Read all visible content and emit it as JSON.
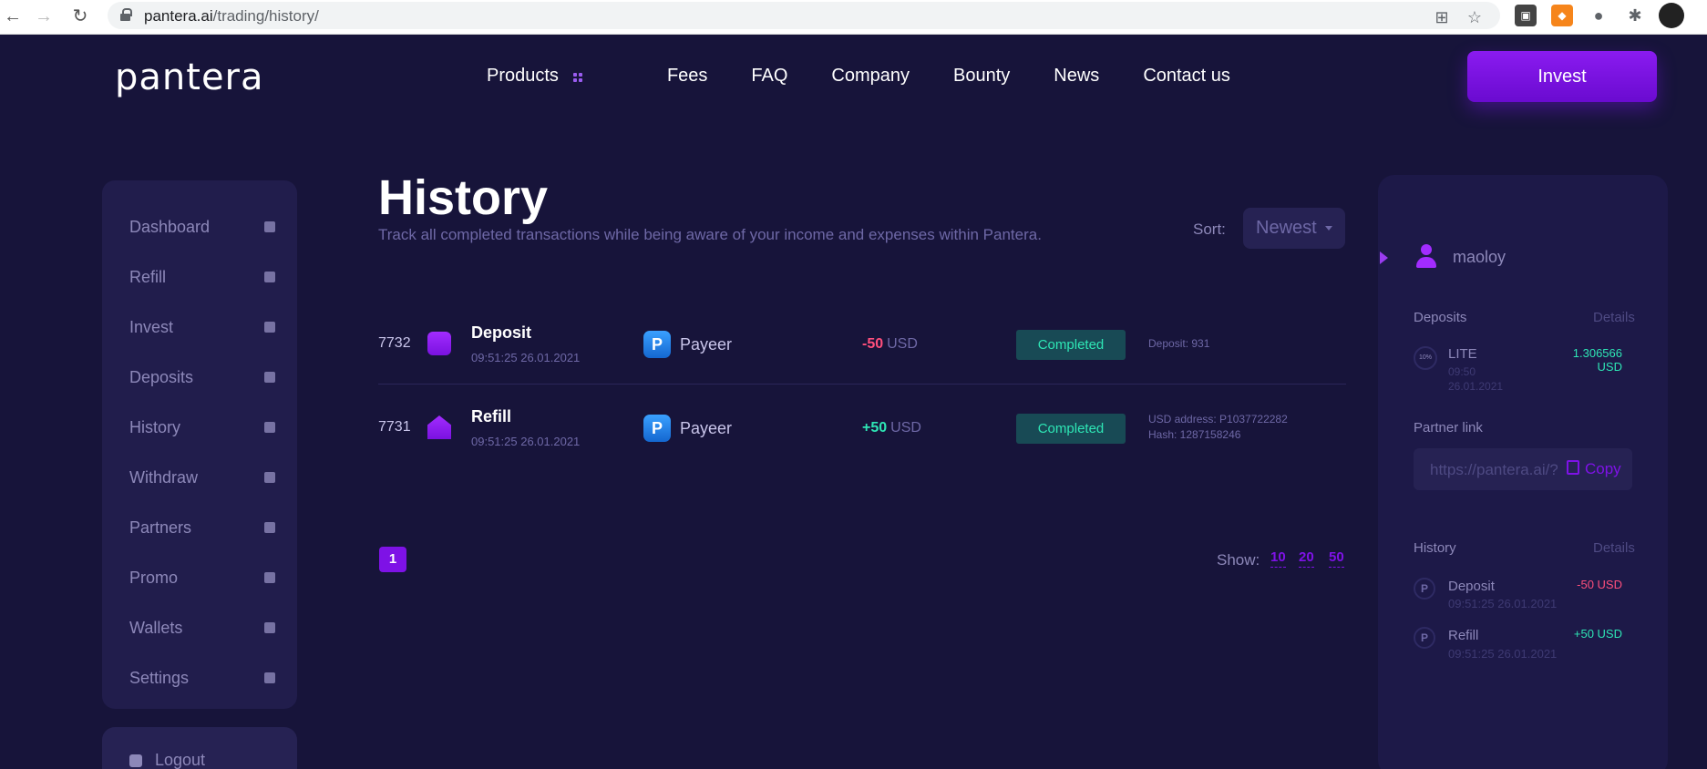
{
  "browser": {
    "url_host": "pantera.ai",
    "url_path": "/trading/history/"
  },
  "header": {
    "logo": "pantera",
    "nav": [
      "Products",
      "Fees",
      "FAQ",
      "Company",
      "Bounty",
      "News",
      "Contact us"
    ],
    "invest_label": "Invest"
  },
  "sidebar": {
    "items": [
      {
        "label": "Dashboard",
        "icon": "home-icon"
      },
      {
        "label": "Refill",
        "icon": "wallet-icon"
      },
      {
        "label": "Invest",
        "icon": "invest-icon"
      },
      {
        "label": "Deposits",
        "icon": "deposits-icon"
      },
      {
        "label": "History",
        "icon": "history-icon"
      },
      {
        "label": "Withdraw",
        "icon": "withdraw-icon"
      },
      {
        "label": "Partners",
        "icon": "partners-icon"
      },
      {
        "label": "Promo",
        "icon": "star-icon"
      },
      {
        "label": "Wallets",
        "icon": "wallets-icon"
      },
      {
        "label": "Settings",
        "icon": "gear-icon"
      }
    ],
    "logout": "Logout"
  },
  "main": {
    "title": "History",
    "subtitle": "Track all completed transactions while being aware of your income and expenses within Pantera.",
    "sort_label": "Sort:",
    "sort_value": "Newest",
    "rows": [
      {
        "id": "7732",
        "type": "Deposit",
        "date": "09:51:25 26.01.2021",
        "method": "Payeer",
        "method_letter": "P",
        "amount": "-50",
        "currency": "USD",
        "status": "Completed",
        "info1": "Deposit: 931",
        "info2": ""
      },
      {
        "id": "7731",
        "type": "Refill",
        "date": "09:51:25 26.01.2021",
        "method": "Payeer",
        "method_letter": "P",
        "amount": "+50",
        "currency": "USD",
        "status": "Completed",
        "info1": "USD address: P1037722282",
        "info2": "Hash: 1287158246"
      }
    ],
    "page": "1",
    "show_label": "Show:",
    "show_options": [
      "10",
      "20",
      "50"
    ]
  },
  "right": {
    "username": "maoloy",
    "deposits_title": "Deposits",
    "deposits_details": "Details",
    "deposit": {
      "name": "LITE",
      "time": "09:50",
      "date": "26.01.2021",
      "amount": "1.306566 USD",
      "badge": "10%"
    },
    "partner_title": "Partner link",
    "partner_value": "https://pantera.ai/?",
    "copy_label": "Copy",
    "history_title": "History",
    "history_details": "Details",
    "history": [
      {
        "name": "Deposit",
        "date": "09:51:25 26.01.2021",
        "amount": "-50 USD",
        "letter": "P"
      },
      {
        "name": "Refill",
        "date": "09:51:25 26.01.2021",
        "amount": "+50 USD",
        "letter": "P"
      }
    ]
  },
  "colors": {
    "background": "#17143a",
    "accent": "#7e12e6",
    "positive": "#2ee6b5",
    "negative": "#ff4f7c"
  }
}
